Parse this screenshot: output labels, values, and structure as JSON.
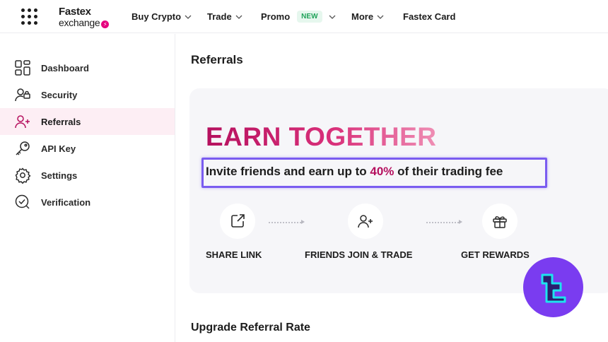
{
  "header": {
    "logo_top": "Fastex",
    "logo_bottom": "exchange",
    "nav": {
      "buy_crypto": "Buy Crypto",
      "trade": "Trade",
      "promo": "Promo",
      "promo_badge": "NEW",
      "more": "More",
      "fastex_card": "Fastex Card"
    }
  },
  "sidebar": {
    "items": [
      {
        "label": "Dashboard",
        "icon": "dashboard-icon"
      },
      {
        "label": "Security",
        "icon": "user-lock-icon"
      },
      {
        "label": "Referrals",
        "icon": "user-plus-icon",
        "active": true
      },
      {
        "label": "API Key",
        "icon": "key-icon"
      },
      {
        "label": "Settings",
        "icon": "gear-icon"
      },
      {
        "label": "Verification",
        "icon": "verified-check-icon"
      }
    ]
  },
  "main": {
    "page_title": "Referrals",
    "hero": {
      "headline": "EARN TOGETHER",
      "subtitle_before": "Invite friends and earn up to ",
      "subtitle_highlight": "40%",
      "subtitle_after": " of their trading fee"
    },
    "steps": [
      {
        "label": "SHARE LINK",
        "icon": "share-link-icon"
      },
      {
        "label": "FRIENDS JOIN & TRADE",
        "icon": "user-plus-icon"
      },
      {
        "label": "GET REWARDS",
        "icon": "gift-icon"
      }
    ],
    "section_title": "Upgrade Referral Rate"
  },
  "colors": {
    "accent": "#b5105e",
    "active_bg": "#fdeef4",
    "highlight_border": "#7a5cf0",
    "card_bg": "#f6f6f9",
    "new_badge": "#20a35a"
  }
}
